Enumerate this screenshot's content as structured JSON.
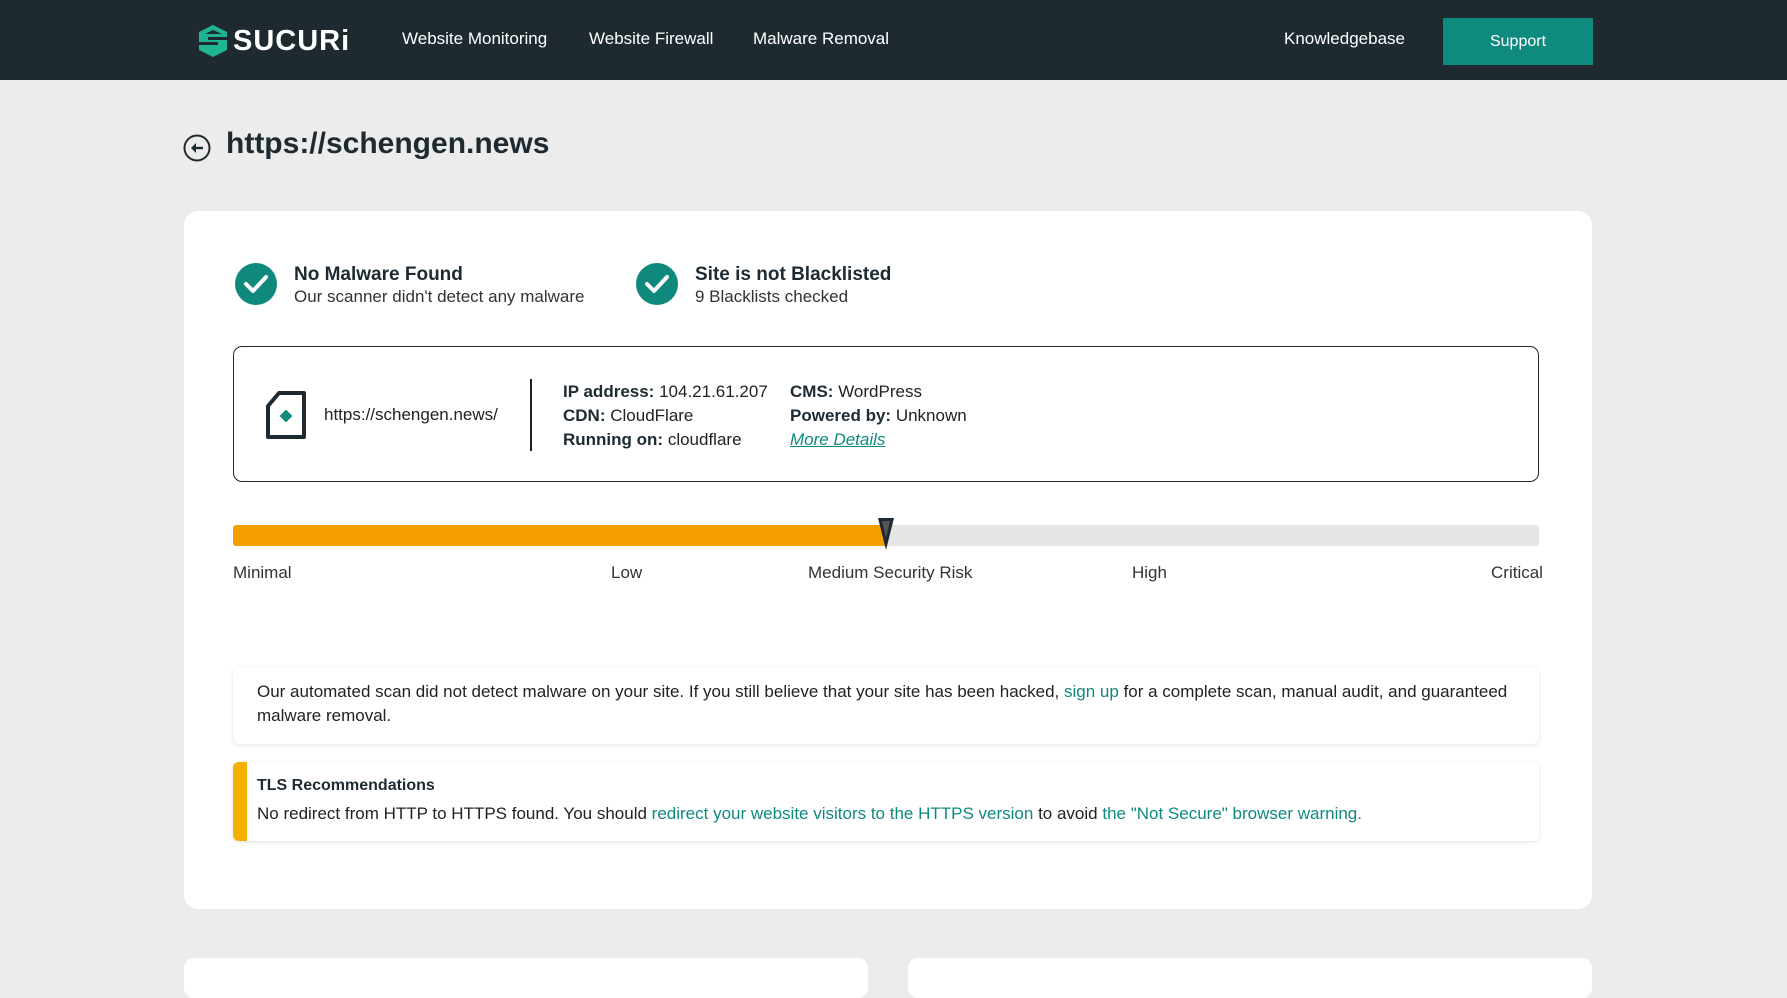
{
  "nav": {
    "logo_text": "SUCURi",
    "links": [
      "Website Monitoring",
      "Website Firewall",
      "Malware Removal"
    ],
    "knowledgebase": "Knowledgebase",
    "support": "Support"
  },
  "page_title": "https://schengen.news",
  "status": {
    "malware_title": "No Malware Found",
    "malware_sub": "Our scanner didn't detect any malware",
    "blacklist_title": "Site is not Blacklisted",
    "blacklist_sub": "9 Blacklists checked"
  },
  "site": {
    "url": "https://schengen.news/",
    "ip_label": "IP address:",
    "ip": "104.21.61.207",
    "cdn_label": "CDN:",
    "cdn": "CloudFlare",
    "running_label": "Running on:",
    "running": "cloudflare",
    "cms_label": "CMS:",
    "cms": "WordPress",
    "powered_label": "Powered by:",
    "powered": "Unknown",
    "more_details": "More Details"
  },
  "risk": {
    "level_fraction": 0.5,
    "labels": [
      "Minimal",
      "Low",
      "Medium Security Risk",
      "High",
      "Critical"
    ]
  },
  "notice": {
    "text_before": "Our automated scan did not detect malware on your site. If you still believe that your site has been hacked, ",
    "link": "sign up",
    "text_after": " for a complete scan, manual audit, and guaranteed malware removal."
  },
  "tls": {
    "title": "TLS Recommendations",
    "text1": "No redirect from HTTP to HTTPS found. You should ",
    "link1": "redirect your website visitors to the HTTPS version",
    "text2": " to avoid ",
    "link2": "the \"Not Secure\" browser warning."
  },
  "colors": {
    "nav_bg": "#1f2a30",
    "accent": "#0f8a7e",
    "risk_fill": "#f5a000",
    "warning_bar": "#f5b000"
  },
  "icons": [
    "sucuri-logo-icon",
    "back-arrow-icon",
    "check-icon",
    "site-file-icon",
    "risk-marker-icon"
  ]
}
